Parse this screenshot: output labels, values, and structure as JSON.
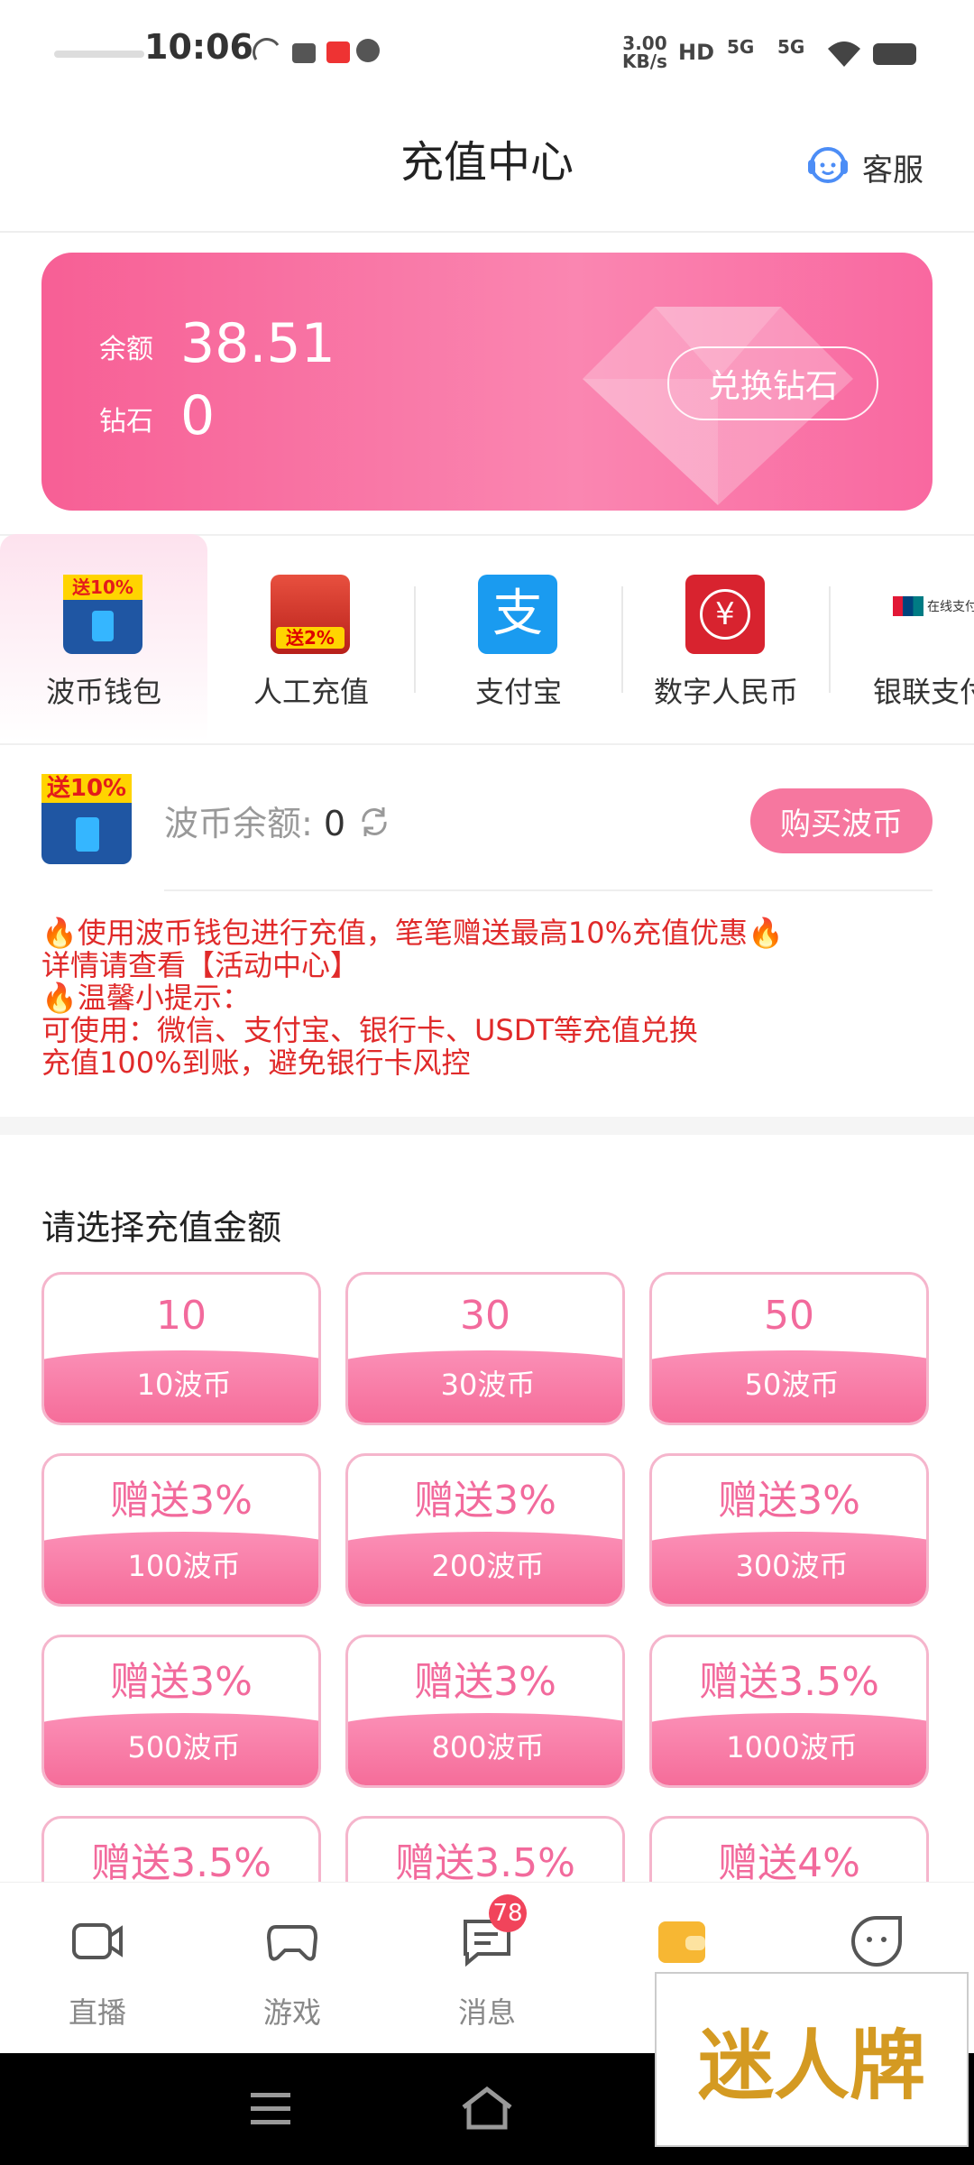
{
  "status_bar": {
    "time": "10:06",
    "net_speed_line1": "3.00",
    "net_speed_line2": "KB/s",
    "hd": "HD",
    "net_a": "5G",
    "net_b": "5G"
  },
  "header": {
    "title": "充值中心",
    "service_label": "客服"
  },
  "balance": {
    "balance_label": "余额",
    "balance_value": "38.51",
    "diamond_label": "钻石",
    "diamond_value": "0",
    "exchange_label": "兑换钻石"
  },
  "payment_methods": [
    {
      "label": "波币钱包",
      "tag": "送10%",
      "icon": "wallet-app-icon",
      "active": true
    },
    {
      "label": "人工充值",
      "tag": "送2%",
      "icon": "manual-recharge-icon"
    },
    {
      "label": "支付宝",
      "tag": "支",
      "icon": "alipay-icon"
    },
    {
      "label": "数字人民币",
      "tag": "¥",
      "icon": "digital-rmb-icon"
    },
    {
      "label": "银联支付",
      "tag": "在线支付",
      "icon": "unionpay-icon"
    }
  ],
  "wallet": {
    "tag": "送10%",
    "balance_label": "波币余额: ",
    "balance_value": "0",
    "buy_label": "购买波币"
  },
  "notice": [
    "🔥使用波币钱包进行充值，笔笔赠送最高10%充值优惠🔥",
    "详情请查看【活动中心】",
    "🔥温馨小提示：",
    "可使用：微信、支付宝、银行卡、USDT等充值兑换",
    "充值100%到账，避免银行卡风控"
  ],
  "amount_section": {
    "title": "请选择充值金额"
  },
  "amounts": [
    {
      "top": "10",
      "bottom": "10波币"
    },
    {
      "top": "30",
      "bottom": "30波币"
    },
    {
      "top": "50",
      "bottom": "50波币"
    },
    {
      "top": "赠送3%",
      "bottom": "100波币"
    },
    {
      "top": "赠送3%",
      "bottom": "200波币"
    },
    {
      "top": "赠送3%",
      "bottom": "300波币"
    },
    {
      "top": "赠送3%",
      "bottom": "500波币"
    },
    {
      "top": "赠送3%",
      "bottom": "800波币"
    },
    {
      "top": "赠送3.5%",
      "bottom": "1000波币"
    },
    {
      "top": "赠送3.5%",
      "bottom": ""
    },
    {
      "top": "赠送3.5%",
      "bottom": ""
    },
    {
      "top": "赠送4%",
      "bottom": ""
    }
  ],
  "nav": [
    {
      "label": "直播",
      "icon": "live-camera-icon"
    },
    {
      "label": "游戏",
      "icon": "gamepad-icon"
    },
    {
      "label": "消息",
      "icon": "message-icon"
    },
    {
      "label": "",
      "icon": "wallet-icon"
    },
    {
      "label": "",
      "icon": "profile-face-icon"
    }
  ],
  "nav_badge": "78",
  "watermark": "迷人牌",
  "colors": {
    "accent": "#f6779f",
    "card_start": "#f75f95",
    "notice": "#e02a2a",
    "wallet_nav": "#f7b733"
  }
}
